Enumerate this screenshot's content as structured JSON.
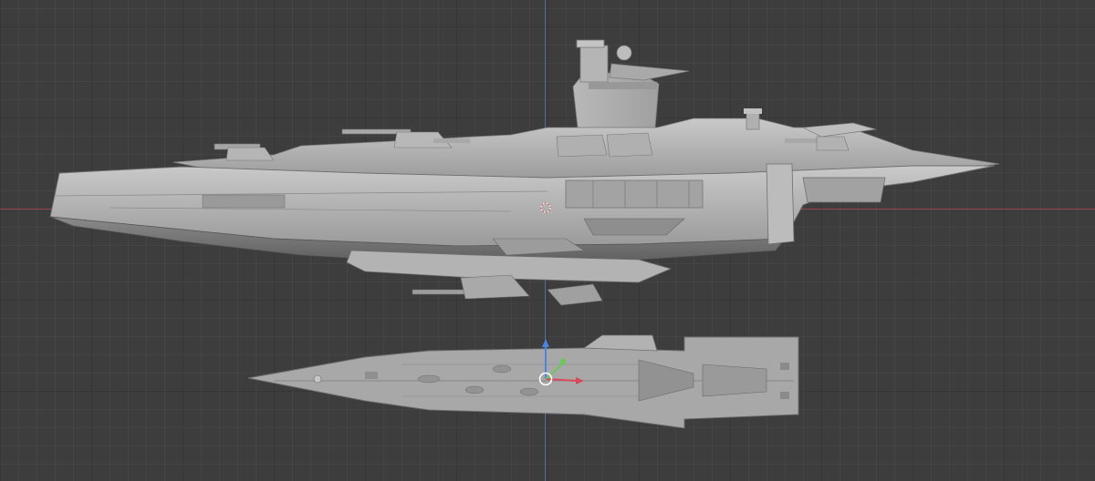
{
  "viewport": {
    "name": "3D Viewport",
    "background": "#3d3d3d",
    "axis_x_color": "#b44e5a",
    "axis_z_color": "#4d7fc2"
  },
  "objects": [
    {
      "name": "battleship-side-view",
      "shading": "solid"
    },
    {
      "name": "battleship-top-view",
      "shading": "solid"
    }
  ],
  "gizmo": {
    "x_color": "#d84a5a",
    "y_color": "#6ec55c",
    "z_color": "#4a86e0",
    "origin_color": "#ffffff"
  }
}
